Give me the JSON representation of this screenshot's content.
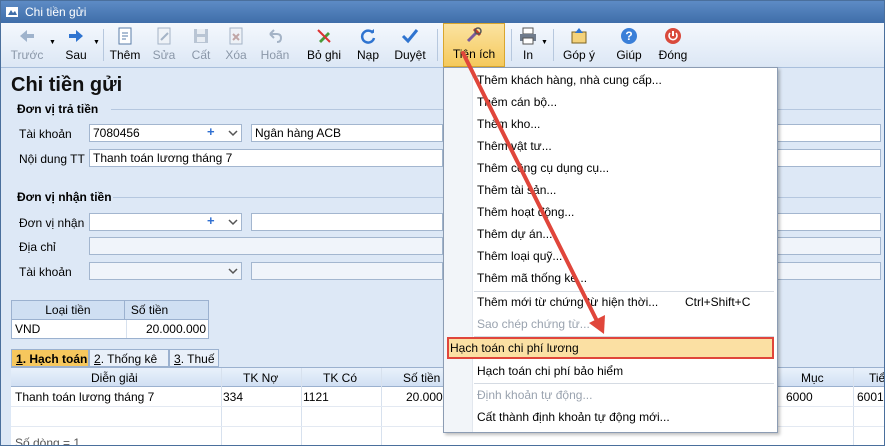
{
  "window": {
    "title": "Chi tiền gửi"
  },
  "toolbar": {
    "back": "Trước",
    "next": "Sau",
    "add": "Thêm",
    "edit": "Sửa",
    "save": "Cất",
    "delete": "Xóa",
    "undo": "Hoãn",
    "unpost": "Bỏ ghi",
    "load": "Nạp",
    "approve": "Duyệt",
    "utilities": "Tiện ích",
    "print": "In",
    "feedback": "Góp ý",
    "help": "Giúp",
    "close": "Đóng"
  },
  "page": {
    "title": "Chi tiền gửi"
  },
  "payer": {
    "group": "Đơn vị trả tiền",
    "account_label": "Tài khoản",
    "account_value": "7080456",
    "bank_name": "Ngân hàng ACB",
    "content_label": "Nội dung TT",
    "content_value": "Thanh toán lương tháng 7"
  },
  "payee": {
    "group": "Đơn vị nhận tiền",
    "unit_label": "Đơn vị nhận",
    "address_label": "Địa chỉ",
    "account_label": "Tài khoản"
  },
  "currency_table": {
    "headers": [
      "Loại tiền",
      "Số tiền"
    ],
    "row": [
      "VND",
      "20.000.000"
    ]
  },
  "tabs": [
    {
      "num": "1",
      "label": ". Hạch toán"
    },
    {
      "num": "2",
      "label": ". Thống kê"
    },
    {
      "num": "3",
      "label": ". Thuế"
    }
  ],
  "grid": {
    "headers": [
      "Diễn giải",
      "TK Nợ",
      "TK Có",
      "Số tiền",
      "Mục",
      "Tiể"
    ],
    "rows": [
      [
        "Thanh toán lương tháng 7",
        "334",
        "1121",
        "20.000.0",
        "6000",
        "6001"
      ]
    ],
    "footer_label": "Số dòng = 1"
  },
  "menu": {
    "items": [
      {
        "label": "Thêm khách hàng, nhà cung cấp..."
      },
      {
        "label": "Thêm cán bộ..."
      },
      {
        "label": "Thêm kho..."
      },
      {
        "label": "Thêm vật tư..."
      },
      {
        "label": "Thêm công cụ dụng cụ..."
      },
      {
        "label": "Thêm tài sản..."
      },
      {
        "label": "Thêm hoạt động..."
      },
      {
        "label": "Thêm dự án..."
      },
      {
        "label": "Thêm loại quỹ..."
      },
      {
        "label": "Thêm mã thống kê..."
      },
      {
        "label": "Thêm mới từ chứng từ hiện thời...",
        "shortcut": "Ctrl+Shift+C"
      },
      {
        "label": "Sao chép chứng từ..."
      },
      {
        "label": "Hạch toán chi phí lương"
      },
      {
        "label": "Hạch toán chi phí bảo hiểm"
      },
      {
        "label": "Định khoản tự động..."
      },
      {
        "label": "Cất thành định khoản tự động mới..."
      }
    ]
  },
  "colors": {
    "titlebar": "#3f6ea9",
    "highlight_fill": "#fbe0a3",
    "highlight_border": "#e0463b",
    "arrow": "#e0463b",
    "active_tab": "#f6c75d"
  }
}
